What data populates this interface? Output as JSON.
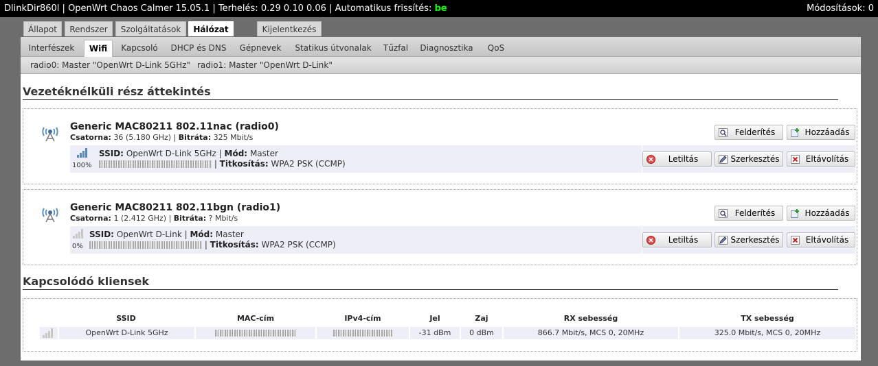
{
  "topbar": {
    "host": "DlinkDir860l",
    "firmware": "OpenWrt Chaos Calmer 15.05.1",
    "load_label": "Terhelés:",
    "load_values": "0.29 0.10 0.06",
    "refresh_label": "Automatikus frissítés:",
    "refresh_state": "be",
    "changes_label": "Módosítások:",
    "changes_count": "0"
  },
  "mainnav": {
    "tabs": [
      "Állapot",
      "Rendszer",
      "Szolgáltatások",
      "Hálózat"
    ],
    "logout": "Kijelentkezés",
    "active": "Hálózat"
  },
  "subnav": {
    "tabs": [
      "Interfészek",
      "Wifi",
      "Kapcsoló",
      "DHCP és DNS",
      "Gépnevek",
      "Statikus útvonalak",
      "Tűzfal",
      "Diagnosztika",
      "QoS"
    ],
    "active": "Wifi"
  },
  "radiobar": {
    "items": [
      "radio0: Master \"OpenWrt D-Link 5GHz\"",
      "radio1: Master \"OpenWrt D-Link\""
    ]
  },
  "overview": {
    "title": "Vezetéknélküli rész áttekintés",
    "labels": {
      "channel": "Csatorna:",
      "bitrate": "Bitráta:",
      "ssid": "SSID:",
      "mode": "Mód:",
      "encryption": "Titkosítás:"
    },
    "buttons": {
      "scan": "Felderítés",
      "add": "Hozzáadás",
      "disable": "Letiltás",
      "edit": "Szerkesztés",
      "remove": "Eltávolítás"
    },
    "radios": [
      {
        "name": "Generic MAC80211 802.11nac (radio0)",
        "channel": "36 (5.180 GHz)",
        "bitrate": "325 Mbit/s",
        "signal_pct": "100%",
        "signal_level": 1.0,
        "ssid": "OpenWrt D-Link 5GHz",
        "mode": "Master",
        "encryption": "WPA2 PSK (CCMP)"
      },
      {
        "name": "Generic MAC80211 802.11bgn (radio1)",
        "channel": "1 (2.412 GHz)",
        "bitrate": "? Mbit/s",
        "signal_pct": "0%",
        "signal_level": 0.0,
        "ssid": "OpenWrt D-Link",
        "mode": "Master",
        "encryption": "WPA2 PSK (CCMP)"
      }
    ]
  },
  "clients": {
    "title": "Kapcsolódó kliensek",
    "headers": [
      "SSID",
      "MAC-cím",
      "IPv4-cím",
      "Jel",
      "Zaj",
      "RX sebesség",
      "TX sebesség"
    ],
    "rows": [
      {
        "ssid": "OpenWrt D-Link 5GHz",
        "signal": "-31 dBm",
        "noise": "0 dBm",
        "rx": "866.7 Mbit/s, MCS 0, 20MHz",
        "tx": "325.0 Mbit/s, MCS 0, 20MHz"
      }
    ]
  },
  "colors": {
    "accent_green": "#00ff00",
    "row_bg": "#eeeef8"
  }
}
